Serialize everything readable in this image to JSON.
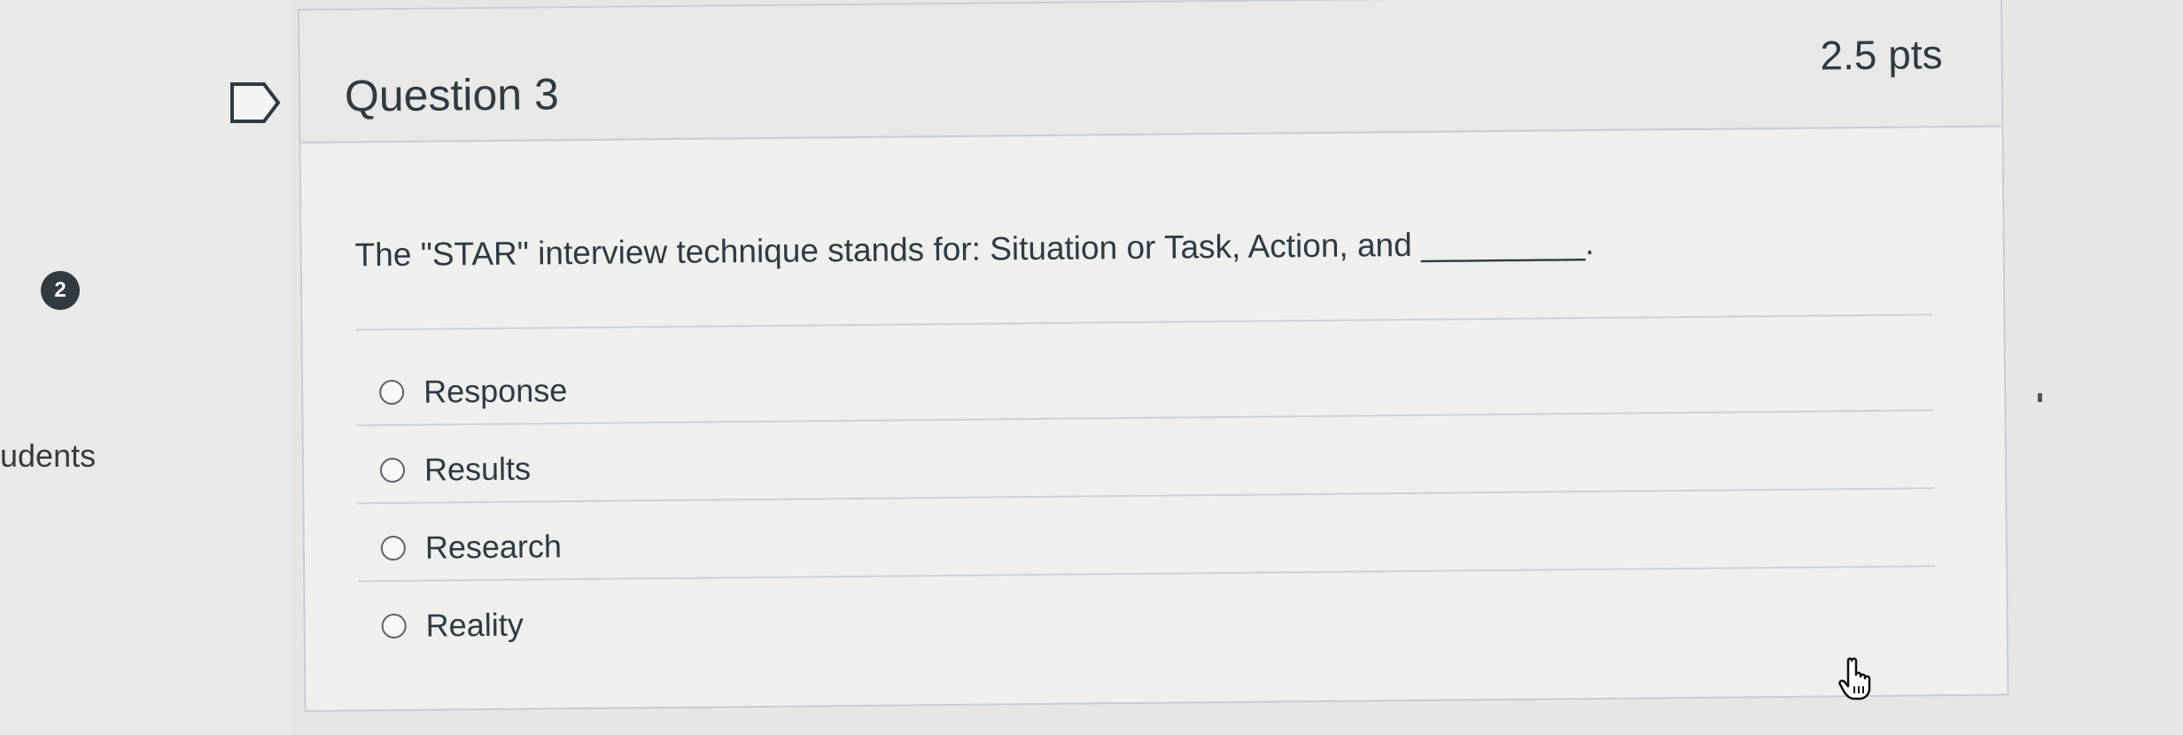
{
  "sidebar": {
    "badge_count": "2",
    "nav_label": "udents"
  },
  "question": {
    "title": "Question 3",
    "points": "2.5 pts",
    "text": "The \"STAR\" interview technique stands for: Situation or Task, Action, and _________.",
    "answers": [
      {
        "label": "Response",
        "selected": false
      },
      {
        "label": "Results",
        "selected": false
      },
      {
        "label": "Research",
        "selected": false
      },
      {
        "label": "Reality",
        "selected": false
      }
    ]
  },
  "icons": {
    "flag": "flag-question-icon",
    "cursor": "hand-pointer-icon"
  },
  "colors": {
    "text": "#2d3b45",
    "border": "#c7cdd1",
    "background": "#e6e6e4",
    "badge": "#333a40"
  }
}
